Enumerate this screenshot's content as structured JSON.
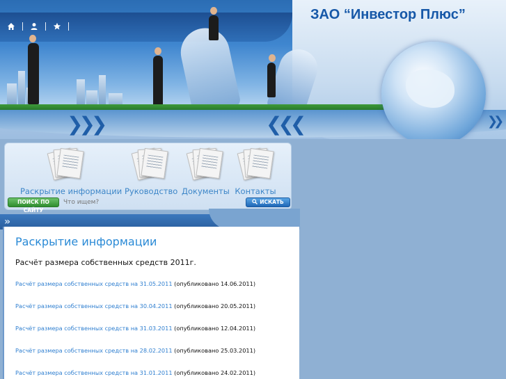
{
  "header": {
    "company_name": "ЗАО “Инвестор Плюс”",
    "icons": [
      "home-icon",
      "user-icon",
      "star-icon"
    ]
  },
  "nav": {
    "items": [
      {
        "label": "Раскрытие информации"
      },
      {
        "label": "Руководство"
      },
      {
        "label": "Документы"
      },
      {
        "label": "Контакты"
      }
    ]
  },
  "search": {
    "site_button": "ПОИСК ПО САЙТУ",
    "placeholder": "Что ищем?",
    "search_button": "ИСКАТЬ"
  },
  "content": {
    "raquo": "»",
    "title": "Раскрытие информации",
    "subtitle": "Расчёт размера собственных средств 2011г.",
    "rows": [
      {
        "link": "Расчёт размера собственных средств на 31.05.2011",
        "published": "(опубликовано 14.06.2011)"
      },
      {
        "link": "Расчёт размера собственных средств на 30.04.2011",
        "published": "(опубликовано 20.05.2011)"
      },
      {
        "link": "Расчёт размера собственных средств на 31.03.2011",
        "published": "(опубликовано 12.04.2011)"
      },
      {
        "link": "Расчёт размера собственных средств на 28.02.2011",
        "published": "(опубликовано 25.03.2011)"
      },
      {
        "link": "Расчёт размера собственных средств на 31.01.2011",
        "published": "(опубликовано 24.02.2011)"
      }
    ]
  },
  "colors": {
    "accent": "#2a8ad6",
    "link": "#2f7fd0",
    "brand": "#1658a8",
    "background": "#8fb0d3"
  }
}
